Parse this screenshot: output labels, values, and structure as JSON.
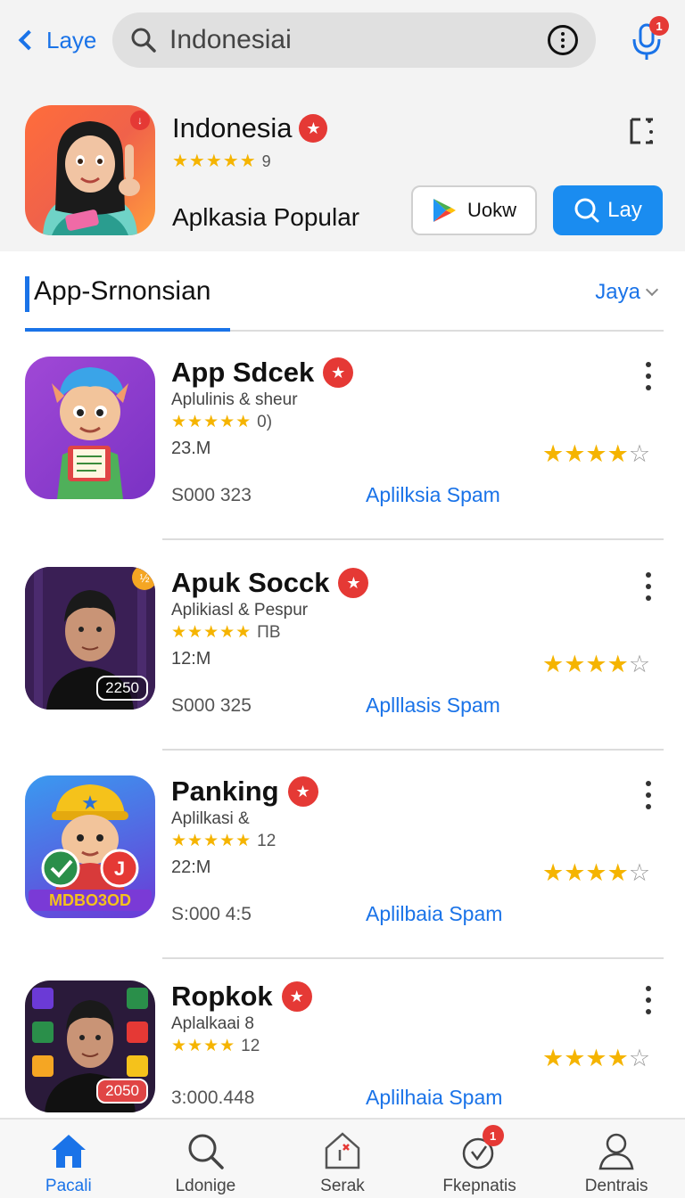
{
  "topbar": {
    "back_label": "Laye",
    "search_value": "Indonesiai",
    "mic_badge": "1"
  },
  "featured": {
    "title": "Indonesia",
    "stars": "★★★★★",
    "rating_count": "9",
    "subtitle": "Aplkasia Popular",
    "play_button": "Uokw",
    "primary_button": "Lay"
  },
  "section": {
    "title": "App-Srnonsian",
    "sort_label": "Jaya"
  },
  "apps": [
    {
      "name": "App Sdcek",
      "category": "Aplulinis & sheur",
      "stars": "★★★★★",
      "rating_count": "0)",
      "size": "23.M",
      "price": "S000 323",
      "tag": "Aplilksia Spam",
      "rating_on": "★★★★",
      "rating_off": "☆"
    },
    {
      "name": "Apuk Socck",
      "category": "Aplikiasl & Pespur",
      "stars": "★★★★★",
      "rating_count": "ΠΒ",
      "size": "12:M",
      "price": "S000 325",
      "tag": "Aplllasis Spam",
      "overlay": "2250",
      "rating_on": "★★★★",
      "rating_off": "☆"
    },
    {
      "name": "Panking",
      "category": "Aplilkasi &",
      "stars": "★★★★★",
      "rating_count": "12",
      "size": "22:M",
      "price": "S:000 4:5",
      "tag": "Aplilbaia Spam",
      "icon_text": "MDBO3OD",
      "rating_on": "★★★★",
      "rating_off": "☆"
    },
    {
      "name": "Ropkok",
      "category": "Aplalkaai 8",
      "stars": "★★★★",
      "rating_count": "12",
      "size": "",
      "price": "3:000.448",
      "tag": "Aplilhaia Spam",
      "overlay": "2050",
      "rating_on": "★★★★",
      "rating_off": "☆"
    }
  ],
  "nav": [
    {
      "label": "Pacali",
      "icon": "home-icon"
    },
    {
      "label": "Ldonige",
      "icon": "search-icon"
    },
    {
      "label": "Serak",
      "icon": "store-icon"
    },
    {
      "label": "Fkepnatis",
      "icon": "updates-icon",
      "badge": "1"
    },
    {
      "label": "Dentrais",
      "icon": "profile-icon"
    }
  ],
  "colors": {
    "accent": "#1a73e8",
    "badge_red": "#e53935",
    "star": "#f5b400"
  }
}
